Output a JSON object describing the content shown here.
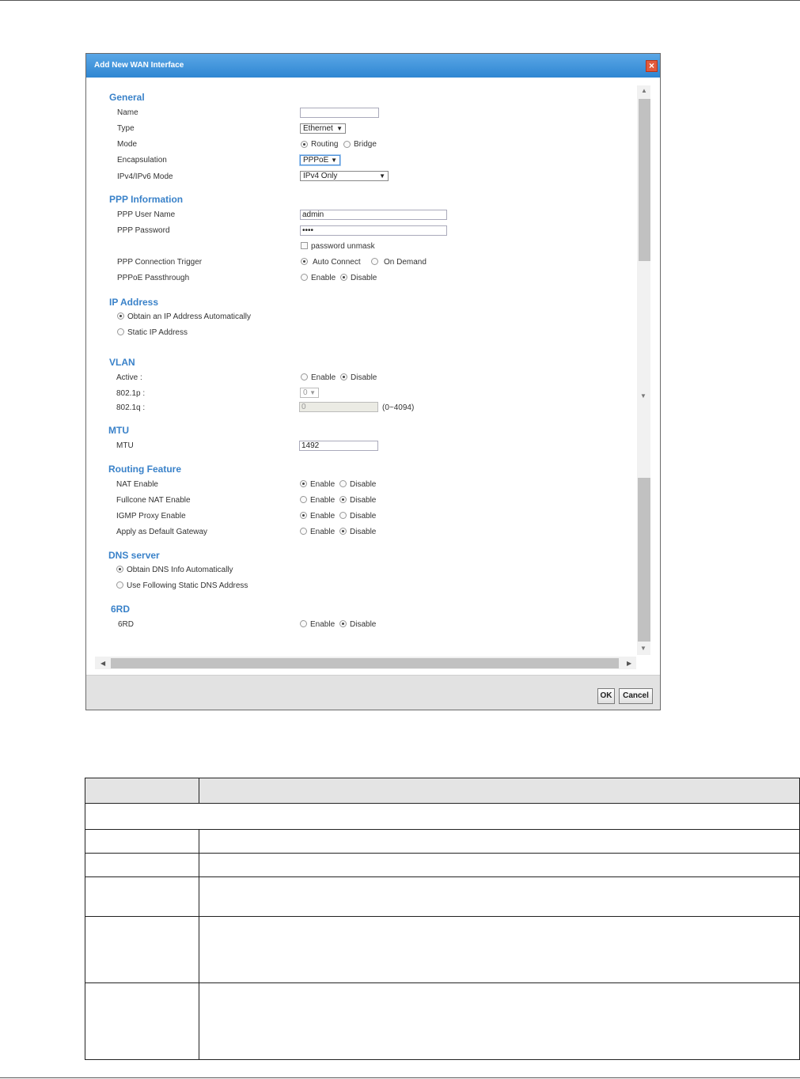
{
  "dialog": {
    "title": "Add New WAN Interface",
    "close_icon": "close-icon",
    "ok_label": "OK",
    "cancel_label": "Cancel"
  },
  "general": {
    "heading": "General",
    "name_label": "Name",
    "name_value": "",
    "type_label": "Type",
    "type_value": "Ethernet",
    "mode_label": "Mode",
    "mode_routing": "Routing",
    "mode_bridge": "Bridge",
    "mode_selected": "Routing",
    "encap_label": "Encapsulation",
    "encap_value": "PPPoE",
    "ipmode_label": "IPv4/IPv6 Mode",
    "ipmode_value": "IPv4 Only"
  },
  "ppp": {
    "heading": "PPP Information",
    "user_label": "PPP User Name",
    "user_value": "admin",
    "pass_label": "PPP Password",
    "pass_value": "••••",
    "unmask_label": "password unmask",
    "trigger_label": "PPP Connection Trigger",
    "trigger_auto": "Auto Connect",
    "trigger_demand": "On Demand",
    "passthrough_label": "PPPoE Passthrough",
    "enable": "Enable",
    "disable": "Disable"
  },
  "ip": {
    "heading": "IP Address",
    "auto": "Obtain an IP Address Automatically",
    "static": "Static IP Address"
  },
  "vlan": {
    "heading": "VLAN",
    "active_label": "Active :",
    "p_label": "802.1p :",
    "p_value": "0",
    "q_label": "802.1q :",
    "q_value": "0",
    "q_range": "(0~4094)",
    "enable": "Enable",
    "disable": "Disable"
  },
  "mtu": {
    "heading": "MTU",
    "label": "MTU",
    "value": "1492"
  },
  "routing": {
    "heading": "Routing Feature",
    "nat": "NAT Enable",
    "fullcone": "Fullcone NAT Enable",
    "igmp": "IGMP Proxy Enable",
    "gateway": "Apply as Default Gateway",
    "enable": "Enable",
    "disable": "Disable"
  },
  "dns": {
    "heading": "DNS server",
    "auto": "Obtain DNS Info Automatically",
    "static": "Use Following Static DNS Address"
  },
  "sixrd": {
    "heading": "6RD",
    "label": "6RD",
    "enable": "Enable",
    "disable": "Disable"
  }
}
